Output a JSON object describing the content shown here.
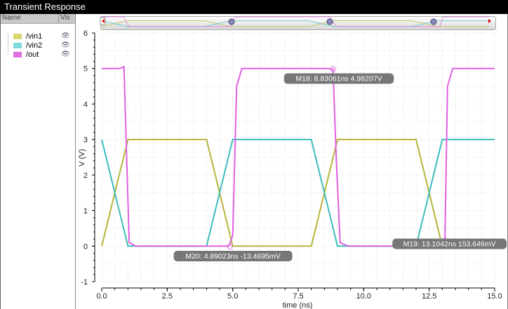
{
  "window": {
    "title": "Transient Response"
  },
  "legend": {
    "headers": {
      "name": "Name",
      "vis": "Vis"
    },
    "items": [
      {
        "label": "/vin1",
        "color": "#b5b53c"
      },
      {
        "label": "/vin2",
        "color": "#3cbcbc"
      },
      {
        "label": "/out",
        "color": "#e060e0"
      }
    ]
  },
  "chart_data": {
    "type": "line",
    "title": "Transient Response",
    "xlabel": "time (ns)",
    "ylabel": "V (V)",
    "xlim": [
      0,
      15
    ],
    "ylim": [
      -1,
      6
    ],
    "xticks": [
      "0.0",
      "2.5",
      "5.0",
      "7.5",
      "10.0",
      "12.5",
      "15.0"
    ],
    "yticks": [
      "-1",
      "0",
      "1",
      "2",
      "3",
      "4",
      "5",
      "6"
    ],
    "grid": true,
    "series": [
      {
        "name": "/vin1",
        "color": "#b5b53c",
        "x": [
          0,
          1,
          4,
          5,
          8,
          9,
          12,
          13,
          15
        ],
        "y": [
          0,
          3,
          3,
          0,
          0,
          3,
          3,
          0,
          0
        ]
      },
      {
        "name": "/vin2",
        "color": "#3cbcbc",
        "x": [
          0,
          1,
          4,
          5,
          8,
          9,
          12,
          13,
          15
        ],
        "y": [
          3,
          0,
          0,
          3,
          3,
          0,
          0,
          3,
          3
        ]
      },
      {
        "name": "/out",
        "color": "#e060e0",
        "x": [
          0,
          0.7,
          0.85,
          0.95,
          1.05,
          1.3,
          4.85,
          5.0,
          5.15,
          5.35,
          8.6,
          8.83,
          8.95,
          9.1,
          9.4,
          13.0,
          13.1,
          13.2,
          13.4,
          15
        ],
        "y": [
          5,
          5,
          5.05,
          2.5,
          0.1,
          0,
          0,
          0.3,
          4.5,
          5,
          5,
          4.98,
          2.5,
          0.1,
          0,
          0,
          0.15,
          4.5,
          5,
          5
        ]
      }
    ],
    "markers": [
      {
        "label": "M18: 8.83061ns 4.98207V",
        "x": 8.83061,
        "y": 4.98207
      },
      {
        "label": "M20: 4.89023ns -13.4695mV",
        "x": 4.89023,
        "y": -0.0134695
      },
      {
        "label": "M19: 13.1042ns 153.646mV",
        "x": 13.1042,
        "y": 0.153646
      }
    ]
  }
}
